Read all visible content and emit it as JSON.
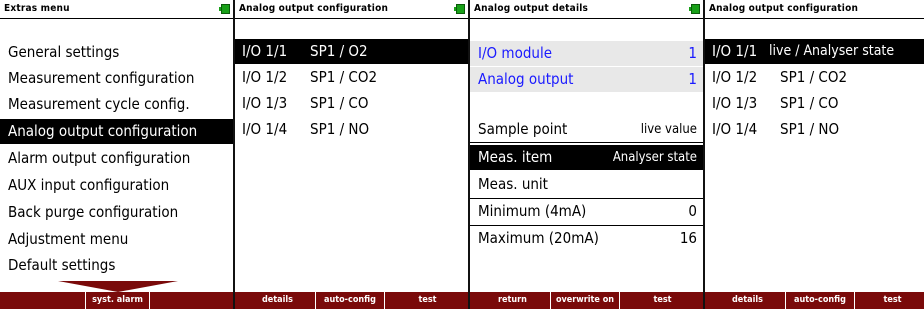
{
  "screen1": {
    "title": "Extras menu",
    "items": [
      "General settings",
      "Measurement configuration",
      "Measurement cycle config.",
      "Analog output configuration",
      "Alarm output configuration",
      "AUX input configuration",
      "Back purge configuration",
      "Adjustment menu",
      "Default settings"
    ],
    "selected_index": 3,
    "footer": [
      "",
      "syst. alarm",
      ""
    ]
  },
  "screen2": {
    "title": "Analog output configuration",
    "rows": [
      {
        "io": "I/O 1/1",
        "value": "SP1 / O2"
      },
      {
        "io": "I/O 1/2",
        "value": "SP1 / CO2"
      },
      {
        "io": "I/O 1/3",
        "value": "SP1 / CO"
      },
      {
        "io": "I/O 1/4",
        "value": "SP1 / NO"
      }
    ],
    "selected_index": 0,
    "footer": [
      "details",
      "auto-config",
      "test"
    ]
  },
  "screen3": {
    "title": "Analog output details",
    "module_label": "I/O module",
    "module_value": "1",
    "output_label": "Analog output",
    "output_value": "1",
    "sample_label": "Sample point",
    "sample_value": "live value",
    "item_label": "Meas. item",
    "item_value": "Analyser state",
    "unit_label": "Meas. unit",
    "unit_value": "",
    "min_label": "Minimum (4mA)",
    "min_value": "0",
    "max_label": "Maximum (20mA)",
    "max_value": "16",
    "footer": [
      "return",
      "overwrite on",
      "test"
    ]
  },
  "screen4": {
    "title": "Analog output configuration",
    "rows": [
      {
        "io": "I/O 1/1",
        "value": "live / Analyser state"
      },
      {
        "io": "I/O 1/2",
        "value": "SP1 / CO2"
      },
      {
        "io": "I/O 1/3",
        "value": "SP1 / CO"
      },
      {
        "io": "I/O 1/4",
        "value": "SP1 / NO"
      }
    ],
    "selected_index": 0,
    "footer": [
      "details",
      "auto-config",
      "test"
    ]
  },
  "colors": {
    "footer": "#7a0a0a",
    "battery": "#18a018",
    "highlight_text": "#1a1aff",
    "selection": "#000000"
  }
}
